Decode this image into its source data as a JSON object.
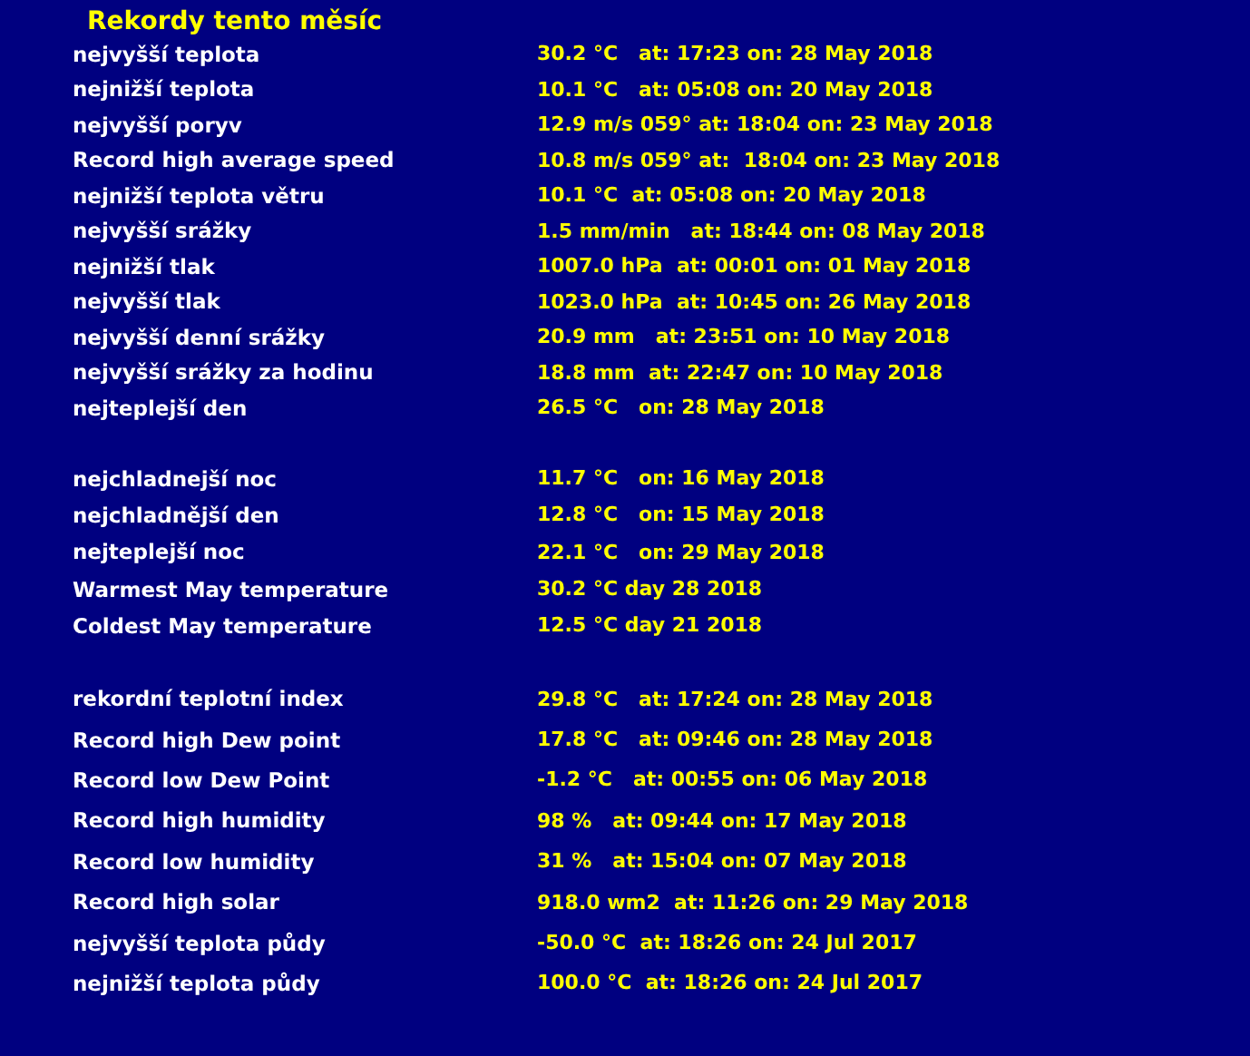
{
  "title": "Rekordy tento měsíc",
  "groups": [
    {
      "rows": [
        {
          "label": "nejvyšší teplota",
          "value": "30.2 °C   at: 17:23 on: 28 May 2018"
        },
        {
          "label": "nejnižší teplota",
          "value": "10.1 °C   at: 05:08 on: 20 May 2018"
        },
        {
          "label": "nejvyšší poryv",
          "value": "12.9 m/s 059° at: 18:04 on: 23 May 2018"
        },
        {
          "label": "Record high average speed",
          "value": "10.8 m/s 059° at:  18:04 on: 23 May 2018"
        },
        {
          "label": "nejnižší teplota větru",
          "value": "10.1 °C  at: 05:08 on: 20 May 2018"
        },
        {
          "label": "nejvyšší srážky",
          "value": "1.5 mm/min   at: 18:44 on: 08 May 2018"
        },
        {
          "label": "nejnižší tlak",
          "value": "1007.0 hPa  at: 00:01 on: 01 May 2018"
        },
        {
          "label": "nejvyšší tlak",
          "value": "1023.0 hPa  at: 10:45 on: 26 May 2018"
        },
        {
          "label": "nejvyšší denní srážky",
          "value": "20.9 mm   at: 23:51 on: 10 May 2018"
        },
        {
          "label": "nejvyšší srážky za hodinu",
          "value": "18.8 mm  at: 22:47 on: 10 May 2018"
        },
        {
          "label": "nejteplejší den",
          "value": "26.5 °C   on: 28 May 2018"
        }
      ]
    },
    {
      "rows": [
        {
          "label": "nejchladnejší noc",
          "value": "11.7 °C   on: 16 May 2018"
        },
        {
          "label": "nejchladnější den",
          "value": "12.8 °C   on: 15 May 2018"
        },
        {
          "label": "nejteplejší noc",
          "value": "22.1 °C   on: 29 May 2018"
        },
        {
          "label": "Warmest May temperature",
          "value": "30.2 °C day 28 2018"
        },
        {
          "label": "Coldest May temperature",
          "value": "12.5 °C day 21 2018"
        }
      ]
    },
    {
      "rows": [
        {
          "label": "rekordní teplotní index",
          "value": "29.8 °C   at: 17:24 on: 28 May 2018"
        },
        {
          "label": "Record high Dew point",
          "value": "17.8 °C   at: 09:46 on: 28 May 2018"
        },
        {
          "label": "Record low Dew Point",
          "value": "-1.2 °C   at: 00:55 on: 06 May 2018"
        },
        {
          "label": "Record high humidity",
          "value": "98 %   at: 09:44 on: 17 May 2018"
        },
        {
          "label": "Record low humidity",
          "value": "31 %   at: 15:04 on: 07 May 2018"
        },
        {
          "label": "Record high solar",
          "value": "918.0 wm2  at: 11:26 on: 29 May 2018"
        },
        {
          "label": "nejvyšší teplota půdy",
          "value": "-50.0 °C  at: 18:26 on: 24 Jul 2017"
        },
        {
          "label": "nejnižší teplota půdy",
          "value": "100.0 °C  at: 18:26 on: 24 Jul 2017"
        }
      ]
    }
  ]
}
